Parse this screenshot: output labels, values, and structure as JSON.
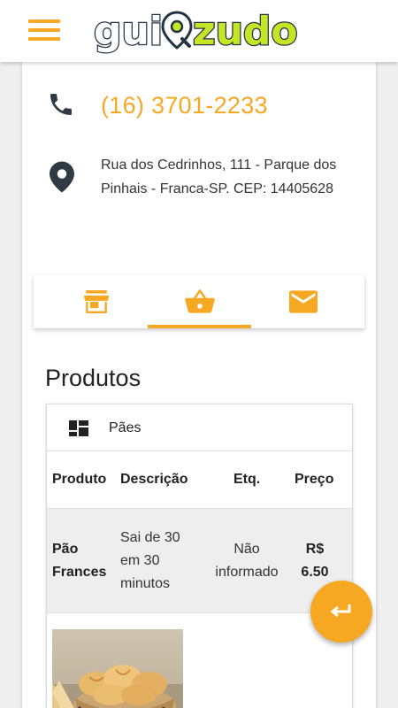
{
  "header": {
    "logo_text": "guiazudo",
    "menu_icon": "menu-icon"
  },
  "contact": {
    "phone": "(16) 3701-2233",
    "address": "Rua dos Cedrinhos, 111 - Parque dos Pinhais - Franca-SP. CEP: 14405628"
  },
  "tabs": [
    {
      "icon": "store-icon",
      "active": false
    },
    {
      "icon": "basket-icon",
      "active": true
    },
    {
      "icon": "mail-icon",
      "active": false
    }
  ],
  "products": {
    "section_title": "Produtos",
    "category": "Pães",
    "columns": [
      "Produto",
      "Descrição",
      "Etq.",
      "Preço"
    ],
    "rows": [
      {
        "produto": "Pão Frances",
        "descricao": "Sai de 30 em 30 minutos",
        "etq": "Não informado",
        "preco": "R$ 6.50"
      }
    ]
  },
  "fab": {
    "icon": "return-icon"
  },
  "colors": {
    "accent": "#f7a823",
    "logo_green": "#c6e526",
    "logo_dark": "#223344",
    "icon_dark": "#2f3a44"
  }
}
